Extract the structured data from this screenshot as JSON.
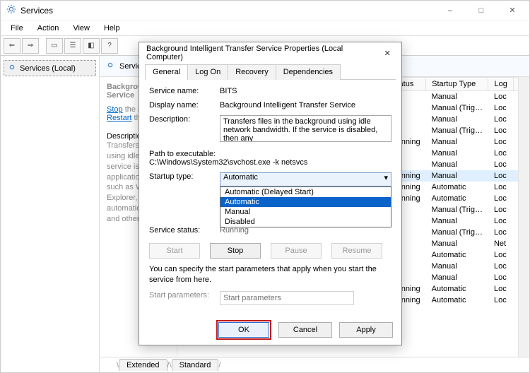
{
  "window": {
    "title": "Services",
    "menus": {
      "file": "File",
      "action": "Action",
      "view": "View",
      "help": "Help"
    },
    "tree": {
      "root": "Services (Local)"
    },
    "content_header": "Services (Local)",
    "bottom_tabs": {
      "extended": "Extended",
      "standard": "Standard"
    }
  },
  "detail": {
    "service_title": "Background Intelligent Transfer Service",
    "stop_link": "Stop",
    "stop_rest": " the service",
    "restart_link": "Restart",
    "restart_rest": " the service",
    "desc_label": "Description:",
    "desc_body": "Transfers files in the background using idle network bandwidth. If the service is disabled, then any applications that depend on BITS, such as Windows Update or MSN Explorer, will be unable to automatically download programs and other information."
  },
  "grid": {
    "headers": {
      "status": "Status",
      "startup": "Startup Type",
      "log": "Log"
    },
    "rows": [
      {
        "status": "",
        "startup": "Manual",
        "log": "Loc"
      },
      {
        "status": "",
        "startup": "Manual (Trig…",
        "log": "Loc"
      },
      {
        "status": "",
        "startup": "Manual",
        "log": "Loc"
      },
      {
        "status": "",
        "startup": "Manual (Trig…",
        "log": "Loc"
      },
      {
        "status": "Running",
        "startup": "Manual",
        "log": "Loc"
      },
      {
        "status": "",
        "startup": "Manual",
        "log": "Loc"
      },
      {
        "status": "",
        "startup": "Manual",
        "log": "Loc"
      },
      {
        "status": "Running",
        "startup": "Manual",
        "log": "Loc",
        "sel": true
      },
      {
        "status": "Running",
        "startup": "Automatic",
        "log": "Loc"
      },
      {
        "status": "Running",
        "startup": "Automatic",
        "log": "Loc"
      },
      {
        "status": "",
        "startup": "Manual (Trig…",
        "log": "Loc"
      },
      {
        "status": "",
        "startup": "Manual",
        "log": "Loc"
      },
      {
        "status": "",
        "startup": "Manual (Trig…",
        "log": "Loc"
      },
      {
        "status": "",
        "startup": "Manual",
        "log": "Net"
      },
      {
        "status": "",
        "startup": "Automatic",
        "log": "Loc"
      },
      {
        "status": "",
        "startup": "Manual",
        "log": "Loc"
      },
      {
        "status": "",
        "startup": "Manual",
        "log": "Loc"
      },
      {
        "status": "Running",
        "startup": "Automatic",
        "log": "Loc"
      },
      {
        "status": "Running",
        "startup": "Automatic",
        "log": "Loc"
      }
    ]
  },
  "dialog": {
    "title": "Background Intelligent Transfer Service Properties (Local Computer)",
    "tabs": {
      "general": "General",
      "logon": "Log On",
      "recovery": "Recovery",
      "deps": "Dependencies"
    },
    "labels": {
      "service_name": "Service name:",
      "display_name": "Display name:",
      "description": "Description:",
      "path": "Path to executable:",
      "startup_type": "Startup type:",
      "service_status": "Service status:",
      "start_params": "Start parameters:"
    },
    "values": {
      "service_name": "BITS",
      "display_name": "Background Intelligent Transfer Service",
      "description": "Transfers files in the background using idle network bandwidth. If the service is disabled, then any",
      "path": "C:\\Windows\\System32\\svchost.exe -k netsvcs",
      "startup_selected": "Automatic",
      "service_status": "Running"
    },
    "dropdown": {
      "opt1": "Automatic (Delayed Start)",
      "opt2": "Automatic",
      "opt3": "Manual",
      "opt4": "Disabled"
    },
    "buttons": {
      "start": "Start",
      "stop": "Stop",
      "pause": "Pause",
      "resume": "Resume",
      "ok": "OK",
      "cancel": "Cancel",
      "apply": "Apply"
    },
    "hint": "You can specify the start parameters that apply when you start the service from here.",
    "params_placeholder": "Start parameters"
  }
}
